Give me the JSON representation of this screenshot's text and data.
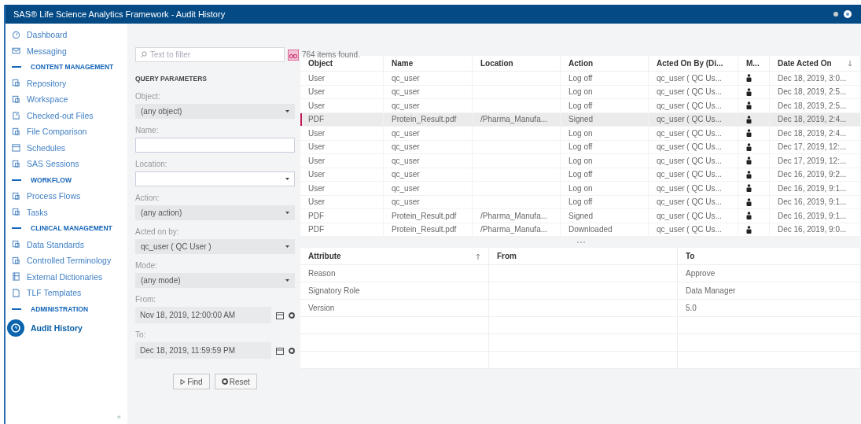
{
  "window": {
    "title": "SAS® Life Science Analytics Framework - Audit History"
  },
  "sidebar": {
    "items": [
      {
        "kind": "link",
        "label": "Dashboard",
        "selected": false
      },
      {
        "kind": "link",
        "label": "Messaging",
        "selected": false
      },
      {
        "kind": "section",
        "label": "CONTENT MANAGEMENT"
      },
      {
        "kind": "link",
        "label": "Repository",
        "selected": false
      },
      {
        "kind": "link",
        "label": "Workspace",
        "selected": false
      },
      {
        "kind": "link",
        "label": "Checked-out Files",
        "selected": false
      },
      {
        "kind": "link",
        "label": "File Comparison",
        "selected": false
      },
      {
        "kind": "link",
        "label": "Schedules",
        "selected": false
      },
      {
        "kind": "link",
        "label": "SAS Sessions",
        "selected": false
      },
      {
        "kind": "section",
        "label": "WORKFLOW"
      },
      {
        "kind": "link",
        "label": "Process Flows",
        "selected": false
      },
      {
        "kind": "link",
        "label": "Tasks",
        "selected": false
      },
      {
        "kind": "section",
        "label": "CLINICAL MANAGEMENT"
      },
      {
        "kind": "link",
        "label": "Data Standards",
        "selected": false
      },
      {
        "kind": "link",
        "label": "Controlled Terminology",
        "selected": false
      },
      {
        "kind": "link",
        "label": "External Dictionaries",
        "selected": false
      },
      {
        "kind": "link",
        "label": "TLF Templates",
        "selected": false
      },
      {
        "kind": "section",
        "label": "ADMINISTRATION"
      },
      {
        "kind": "link",
        "label": "Audit History",
        "selected": true
      }
    ],
    "collapse": "«"
  },
  "filter": {
    "placeholder": "Text to filter",
    "count": "764 items found."
  },
  "query": {
    "title": "QUERY PARAMETERS",
    "fields": [
      {
        "kind": "select",
        "label": "Object:",
        "value": "(any object)"
      },
      {
        "kind": "text",
        "label": "Name:"
      },
      {
        "kind": "select",
        "label": "Location:"
      },
      {
        "kind": "select",
        "label": "Action:",
        "value": "(any action)"
      },
      {
        "kind": "select",
        "label": "Acted on by:",
        "value": "qc_user ( QC User )"
      },
      {
        "kind": "select",
        "label": "Mode:",
        "value": "(any mode)"
      },
      {
        "kind": "date",
        "label": "From:",
        "value": "Nov 18, 2019, 12:00:00 AM"
      },
      {
        "kind": "date",
        "label": "To:",
        "value": "Dec 18, 2019, 11:59:59 PM"
      }
    ],
    "buttons": [
      {
        "kind": "find",
        "label": "Find"
      },
      {
        "kind": "reset",
        "label": "Reset"
      }
    ]
  },
  "table": {
    "columns": [
      "Object",
      "Name",
      "Location",
      "Action",
      "Acted On By (Di...",
      "M...",
      "Date Acted On"
    ],
    "rows": [
      {
        "selected": false,
        "cells": [
          "User",
          "qc_user",
          "",
          "Log off",
          "qc_user ( QC Us...",
          "Dec 18, 2019, 3:0..."
        ]
      },
      {
        "selected": false,
        "cells": [
          "User",
          "qc_user",
          "",
          "Log on",
          "qc_user ( QC Us...",
          "Dec 18, 2019, 2:5..."
        ]
      },
      {
        "selected": false,
        "cells": [
          "User",
          "qc_user",
          "",
          "Log off",
          "qc_user ( QC Us...",
          "Dec 18, 2019, 2:5..."
        ]
      },
      {
        "selected": true,
        "cells": [
          "PDF",
          "Protein_Result.pdf",
          "/Pharma_Manufa...",
          "Signed",
          "qc_user ( QC Us...",
          "Dec 18, 2019, 2:4..."
        ]
      },
      {
        "selected": false,
        "cells": [
          "User",
          "qc_user",
          "",
          "Log on",
          "qc_user ( QC Us...",
          "Dec 18, 2019, 2:4..."
        ]
      },
      {
        "selected": false,
        "cells": [
          "User",
          "qc_user",
          "",
          "Log off",
          "qc_user ( QC Us...",
          "Dec 17, 2019, 12:..."
        ]
      },
      {
        "selected": false,
        "cells": [
          "User",
          "qc_user",
          "",
          "Log on",
          "qc_user ( QC Us...",
          "Dec 17, 2019, 12:..."
        ]
      },
      {
        "selected": false,
        "cells": [
          "User",
          "qc_user",
          "",
          "Log off",
          "qc_user ( QC Us...",
          "Dec 16, 2019, 9:2..."
        ]
      },
      {
        "selected": false,
        "cells": [
          "User",
          "qc_user",
          "",
          "Log on",
          "qc_user ( QC Us...",
          "Dec 16, 2019, 9:1..."
        ]
      },
      {
        "selected": false,
        "cells": [
          "User",
          "qc_user",
          "",
          "Log off",
          "qc_user ( QC Us...",
          "Dec 16, 2019, 9:1..."
        ]
      },
      {
        "selected": false,
        "cells": [
          "PDF",
          "Protein_Result.pdf",
          "/Pharma_Manufa...",
          "Signed",
          "qc_user ( QC Us...",
          "Dec 16, 2019, 9:1..."
        ]
      },
      {
        "selected": false,
        "cells": [
          "PDF",
          "Protein_Result.pdf",
          "/Pharma_Manufa...",
          "Downloaded",
          "qc_user ( QC Us...",
          "Dec 16, 2019, 9:0..."
        ]
      }
    ]
  },
  "details": {
    "columns": [
      "Attribute",
      "From",
      "To"
    ],
    "rows": [
      [
        "Reason",
        "",
        "Approve"
      ],
      [
        "Signatory Role",
        "",
        "Data Manager"
      ],
      [
        "Version",
        "",
        "5.0"
      ]
    ]
  }
}
